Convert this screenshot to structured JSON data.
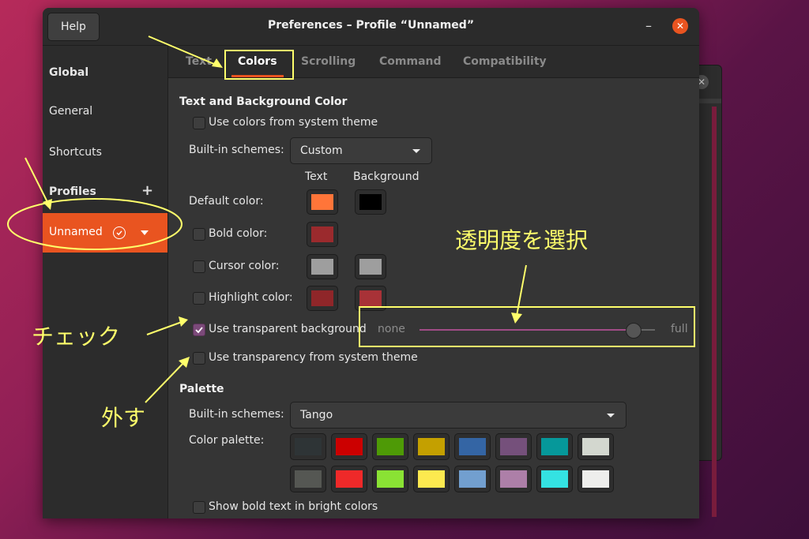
{
  "window": {
    "title": "Preferences – Profile “Unnamed”",
    "help_label": "Help",
    "minimize_label": "–",
    "close_label": "✕"
  },
  "sidebar": {
    "global_heading": "Global",
    "items": [
      {
        "label": "General"
      },
      {
        "label": "Shortcuts"
      }
    ],
    "profiles_heading": "Profiles",
    "add_label": "+",
    "profile_selected": "Unnamed"
  },
  "tabs": [
    {
      "label": "Text"
    },
    {
      "label": "Colors"
    },
    {
      "label": "Scrolling"
    },
    {
      "label": "Command"
    },
    {
      "label": "Compatibility"
    }
  ],
  "colors_tab": {
    "section_text_bg": "Text and Background Color",
    "use_system_theme": "Use colors from system theme",
    "builtin_schemes_label": "Built-in schemes:",
    "builtin_schemes_value": "Custom",
    "col_text": "Text",
    "col_background": "Background",
    "default_color_label": "Default color:",
    "bold_color_label": "Bold color:",
    "cursor_color_label": "Cursor color:",
    "highlight_color_label": "Highlight color:",
    "default_text_color": "#ff7539",
    "default_bg_color": "#000000",
    "bold_color": "#9b2a2d",
    "cursor_text_color": "#9e9e9e",
    "cursor_bg_color": "#9e9e9e",
    "highlight_text_color": "#8f2629",
    "highlight_bg_color": "#a83237",
    "transparent_bg_label": "Use transparent background",
    "transparent_bg_checked": true,
    "slider_min": "none",
    "slider_max": "full",
    "slider_value_fraction": 0.91,
    "transparency_system_label": "Use transparency from system theme",
    "palette_section": "Palette",
    "palette_schemes_label": "Built-in schemes:",
    "palette_schemes_value": "Tango",
    "color_palette_label": "Color palette:",
    "palette_row1": [
      "#2e3436",
      "#cc0000",
      "#4e9a06",
      "#c4a000",
      "#3465a4",
      "#75507b",
      "#06989a",
      "#d3d7cf"
    ],
    "palette_row2": [
      "#555753",
      "#ef2929",
      "#8ae234",
      "#fce94f",
      "#729fcf",
      "#ad7fa8",
      "#34e2e2",
      "#eeeeec"
    ],
    "show_bold_bright": "Show bold text in bright colors"
  },
  "annotations": {
    "select_transparency": "透明度を選択",
    "check": "チェック",
    "uncheck": "外す",
    "accent_color": "#ffff6b"
  }
}
